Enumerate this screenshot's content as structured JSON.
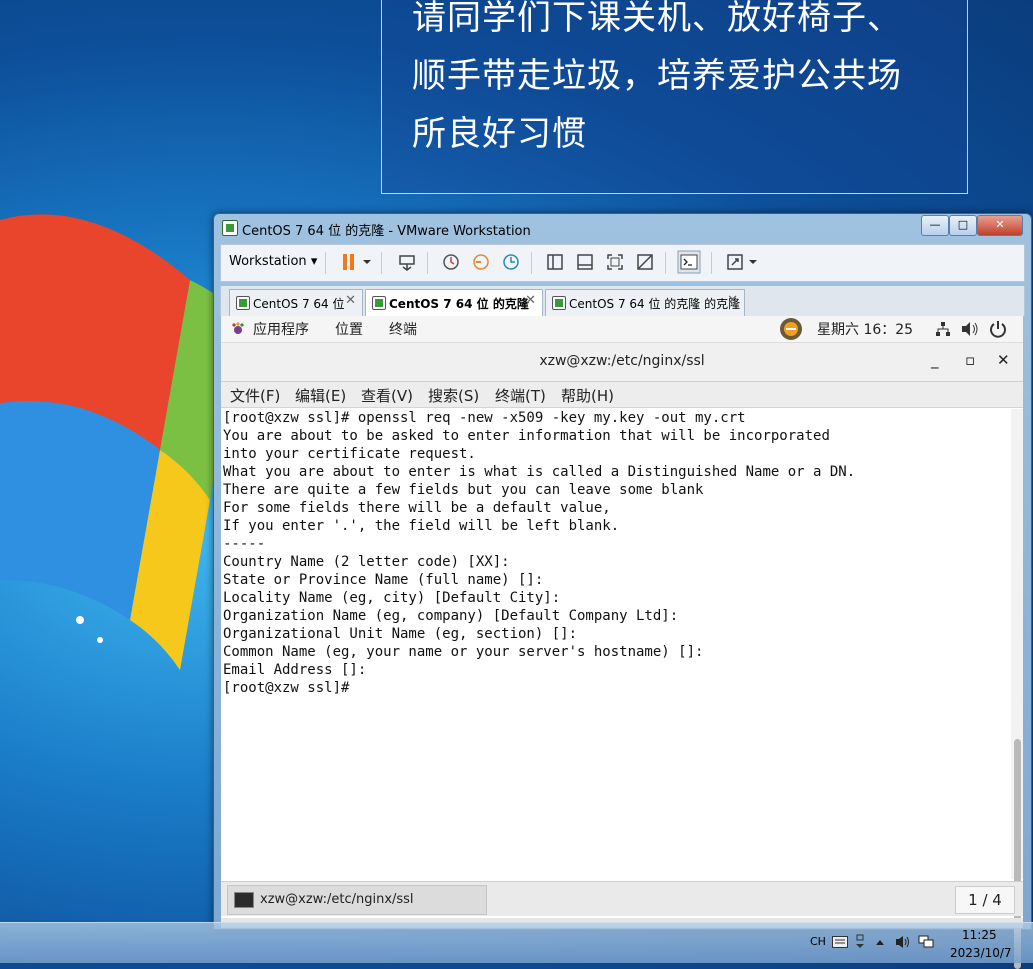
{
  "desktop": {
    "notice_lines": [
      "请同学们下课关机、放好椅子、",
      "顺手带走垃圾，培养爱护公共场",
      "所良好习惯"
    ]
  },
  "vmware": {
    "title": "CentOS 7 64 位 的克隆 - VMware Workstation",
    "controls": {
      "minimize": "—",
      "maximize": "□",
      "close": "✕"
    },
    "toolbar": {
      "workstation_label": "Workstation",
      "dropdown": "▾"
    },
    "tabs": [
      {
        "label": "CentOS 7 64 位",
        "close": "✕"
      },
      {
        "label": "CentOS 7 64 位 的克隆",
        "close": "✕"
      },
      {
        "label": "CentOS 7 64 位 的克隆 的克隆",
        "close": "✕"
      }
    ]
  },
  "gnome": {
    "applications": "应用程序",
    "places": "位置",
    "terminal": "终端",
    "clock": "星期六 16：25"
  },
  "terminal": {
    "title": "xzw@xzw:/etc/nginx/ssl",
    "controls": {
      "minimize": "_",
      "maximize": "▫",
      "close": "✕"
    },
    "menu": [
      "文件(F)",
      "编辑(E)",
      "查看(V)",
      "搜索(S)",
      "终端(T)",
      "帮助(H)"
    ],
    "lines": [
      "[root@xzw ssl]# openssl req -new -x509 -key my.key -out my.crt",
      "You are about to be asked to enter information that will be incorporated",
      "into your certificate request.",
      "What you are about to enter is what is called a Distinguished Name or a DN.",
      "There are quite a few fields but you can leave some blank",
      "For some fields there will be a default value,",
      "If you enter '.', the field will be left blank.",
      "-----",
      "Country Name (2 letter code) [XX]:",
      "State or Province Name (full name) []:",
      "Locality Name (eg, city) [Default City]:",
      "Organization Name (eg, company) [Default Company Ltd]:",
      "Organizational Unit Name (eg, section) []:",
      "Common Name (eg, your name or your server's hostname) []:",
      "Email Address []:",
      "[root@xzw ssl]#"
    ]
  },
  "guest_taskbar": {
    "window_label": "xzw@xzw:/etc/nginx/ssl",
    "pager": "1 / 4"
  },
  "windows_taskbar": {
    "lang": "CH",
    "time": "11:25",
    "date": "2023/10/7"
  },
  "colors": {
    "desktop_blue": "#1a7cc8",
    "pause_orange": "#f07a1a",
    "vmware_frame": "#9fc2e0"
  }
}
